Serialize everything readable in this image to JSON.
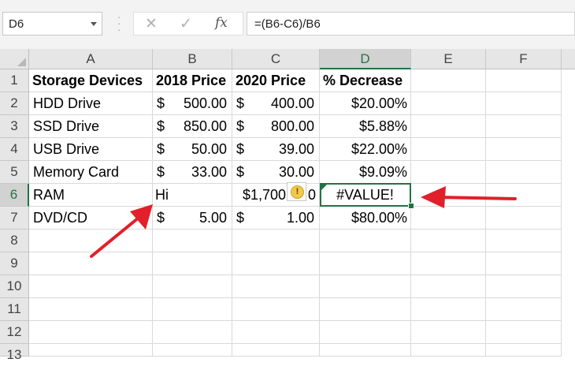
{
  "formula_bar": {
    "name_box": "D6",
    "cancel_icon": "✕",
    "enter_icon": "✓",
    "function_icon": "fx",
    "formula": "=(B6-C6)/B6"
  },
  "columns": [
    "A",
    "B",
    "C",
    "D",
    "E",
    "F"
  ],
  "rows": [
    "1",
    "2",
    "3",
    "4",
    "5",
    "6",
    "7",
    "8",
    "9",
    "10",
    "11",
    "12",
    "13"
  ],
  "headers": {
    "a": "Storage Devices",
    "b": "2018 Price",
    "c": "2020 Price",
    "d": "% Decrease"
  },
  "data_rows": [
    {
      "device": "HDD Drive",
      "p2018_cur": "$",
      "p2018": "500.00",
      "p2020_cur": "$",
      "p2020": "400.00",
      "decrease": "$20.00%"
    },
    {
      "device": "SSD Drive",
      "p2018_cur": "$",
      "p2018": "850.00",
      "p2020_cur": "$",
      "p2020": "800.00",
      "decrease": "$5.88%"
    },
    {
      "device": "USB Drive",
      "p2018_cur": "$",
      "p2018": "50.00",
      "p2020_cur": "$",
      "p2020": "39.00",
      "decrease": "$22.00%"
    },
    {
      "device": "Memory Card",
      "p2018_cur": "$",
      "p2018": "33.00",
      "p2020_cur": "$",
      "p2020": "30.00",
      "decrease": "$9.09%"
    },
    {
      "device": "RAM",
      "p2018_text": "Hi",
      "p2020_text": "$1,700",
      "p2020_tail": "0",
      "decrease": "#VALUE!"
    },
    {
      "device": "DVD/CD",
      "p2018_cur": "$",
      "p2018": "5.00",
      "p2020_cur": "$",
      "p2020": "1.00",
      "decrease": "$80.00%"
    }
  ],
  "selected_cell": "D6",
  "colors": {
    "accent": "#217346",
    "arrow": "#e0202a",
    "warning": "#f2c94c"
  },
  "icons": {
    "warning": "warning-icon",
    "arrow": "red-arrow"
  }
}
